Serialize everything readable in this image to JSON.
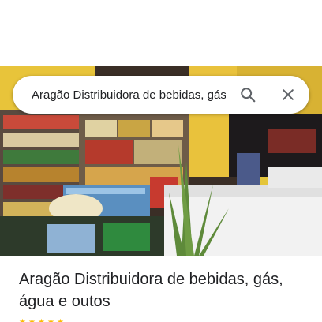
{
  "search": {
    "query": "Aragão Distribuidora de bebidas, gás, água e outos",
    "search_icon": "search-icon",
    "close_icon": "close-icon"
  },
  "place": {
    "photo_description_icon": "store-photo",
    "title": "Aragão Distribuidora de bebidas, gás, água e outos"
  },
  "colors": {
    "accent_star": "#fbbc04",
    "icon_gray": "#5f6368",
    "text": "#202124"
  }
}
